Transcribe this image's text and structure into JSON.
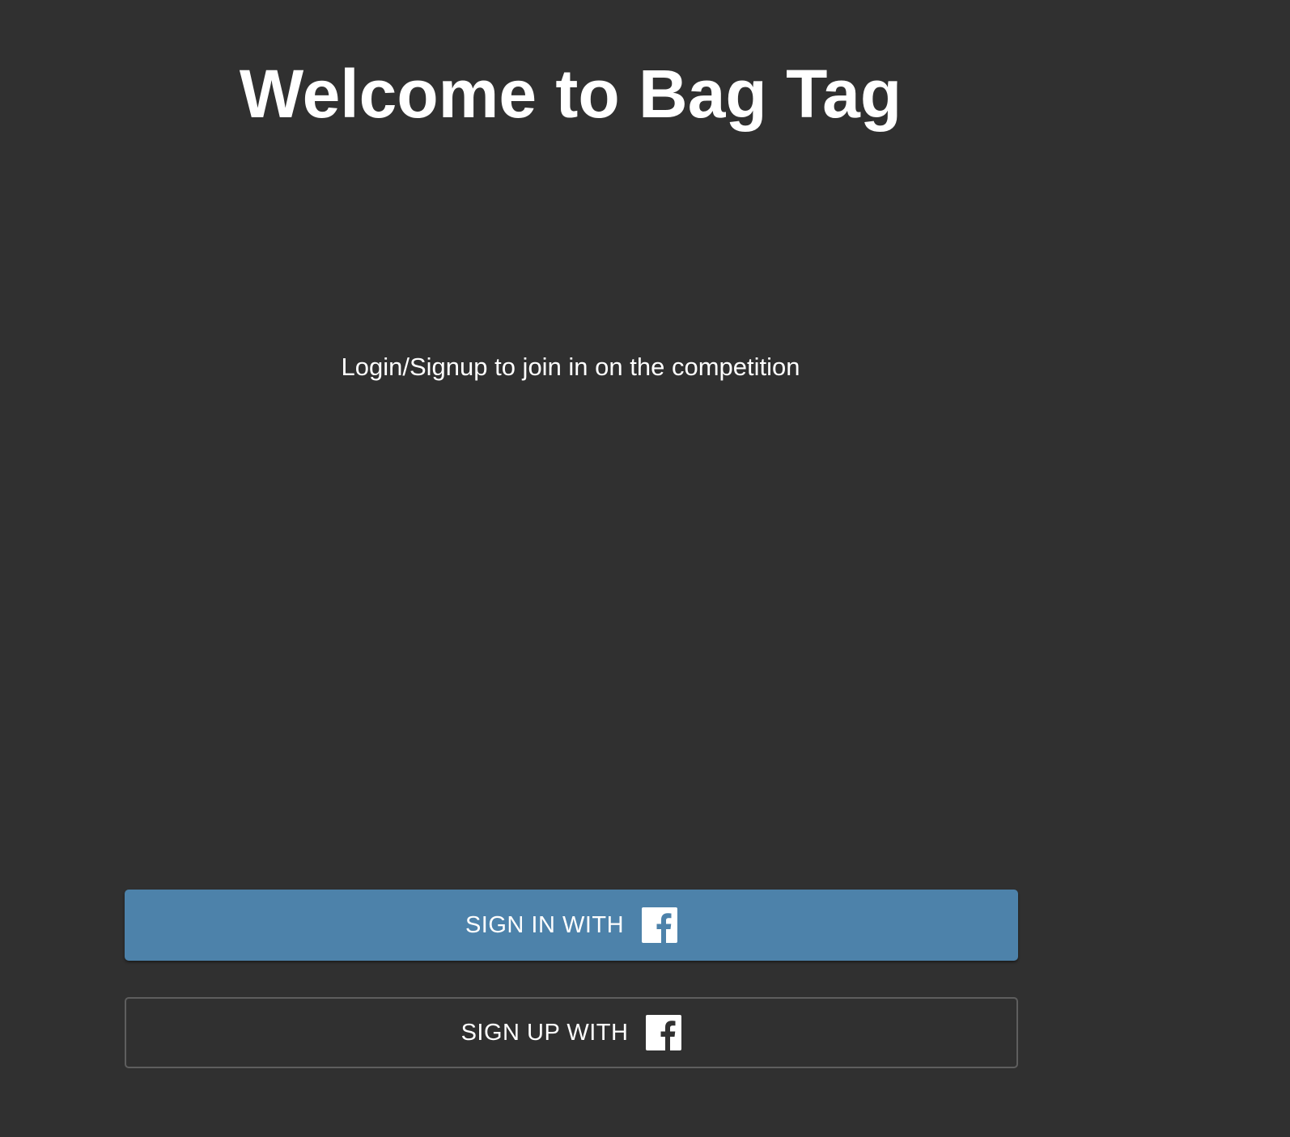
{
  "header": {
    "title": "Welcome to Bag Tag"
  },
  "main": {
    "subtitle": "Login/Signup to join in on the competition"
  },
  "actions": {
    "signin_label": "SIGN IN WITH",
    "signup_label": "SIGN UP WITH",
    "provider_icon": "facebook-icon"
  },
  "colors": {
    "background": "#303030",
    "signin_button": "#4d82aa",
    "signup_border": "#5e5e5e",
    "text": "#ffffff"
  }
}
